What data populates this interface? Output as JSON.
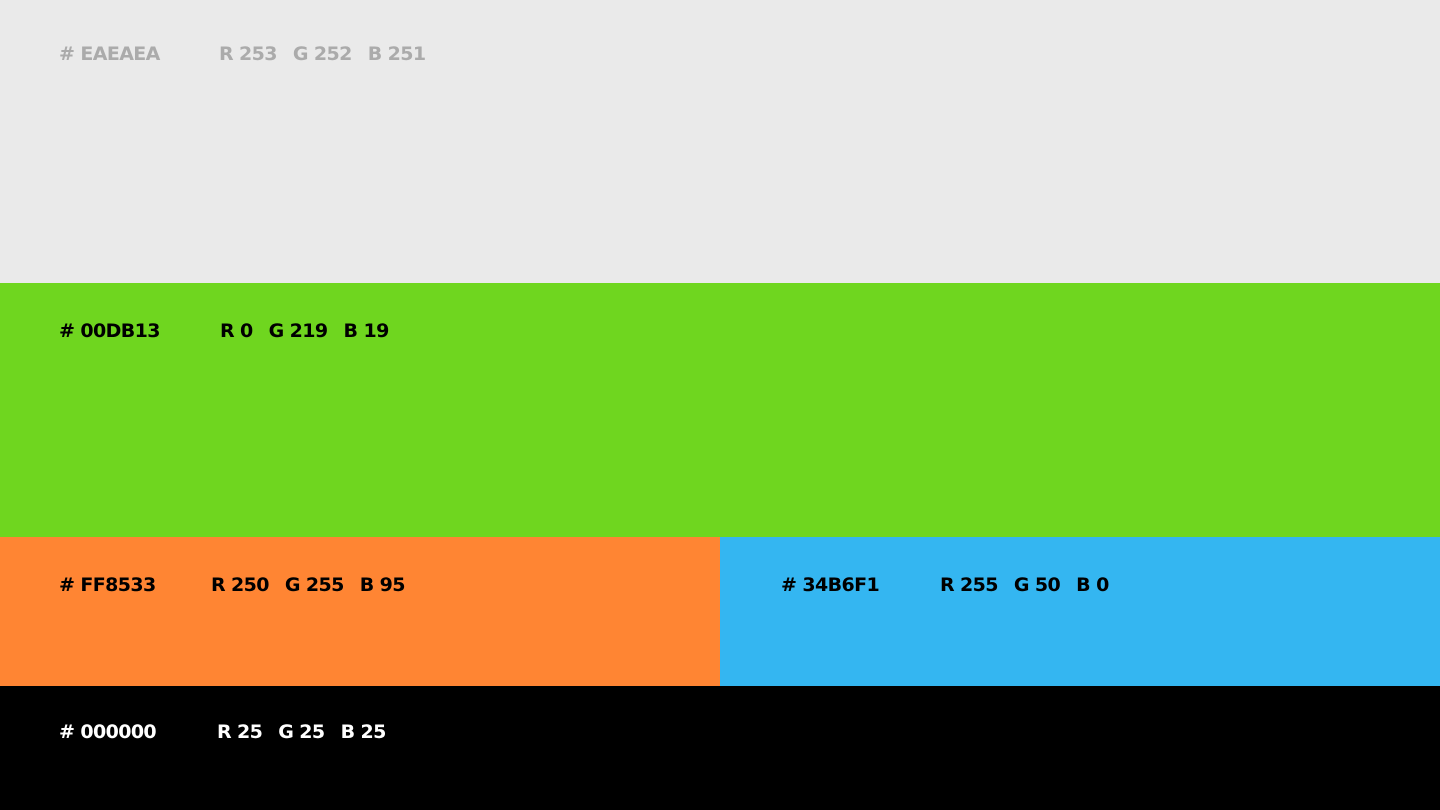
{
  "palette": {
    "swatches": [
      {
        "id": "light",
        "background": "#EAEAEA",
        "text_color": "#ABABAB",
        "hex_label": "# EAEAEA",
        "r_label": "R 253",
        "g_label": "G 252",
        "b_label": "B 251"
      },
      {
        "id": "green",
        "background": "#6FD61F",
        "text_color": "#000000",
        "hex_label": "# 00DB13",
        "r_label": "R 0",
        "g_label": "G 219",
        "b_label": "B 19"
      },
      {
        "id": "orange",
        "background": "#FF8533",
        "text_color": "#000000",
        "hex_label": "# FF8533",
        "r_label": "R 250",
        "g_label": "G 255",
        "b_label": "B 95"
      },
      {
        "id": "blue",
        "background": "#34B6F1",
        "text_color": "#000000",
        "hex_label": "# 34B6F1",
        "r_label": "R 255",
        "g_label": "G 50",
        "b_label": "B 0"
      },
      {
        "id": "black",
        "background": "#000000",
        "text_color": "#FFFFFF",
        "hex_label": "# 000000",
        "r_label": "R 25",
        "g_label": "G 25",
        "b_label": "B 25"
      }
    ]
  }
}
